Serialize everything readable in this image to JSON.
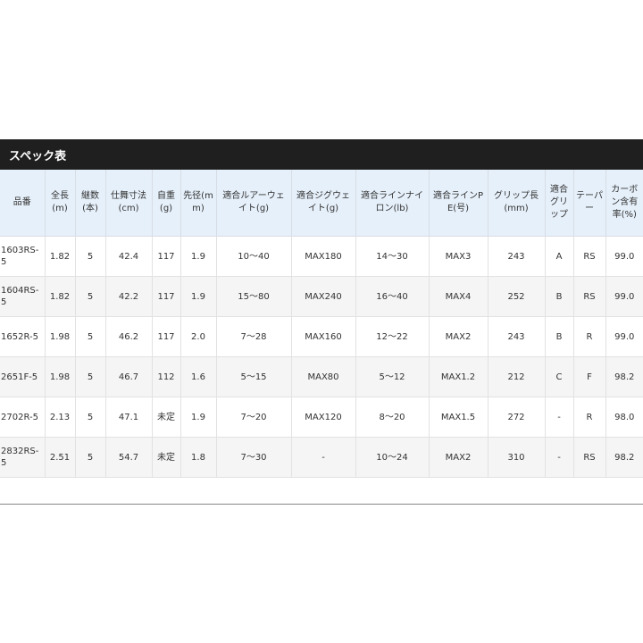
{
  "title": "スペック表",
  "headers": [
    "品番",
    "全長(m)",
    "継数(本)",
    "仕舞寸法(cm)",
    "自重(g)",
    "先径(mm)",
    "適合ルアーウェイト(g)",
    "適合ジグウェイト(g)",
    "適合ラインナイロン(lb)",
    "適合ラインPE(号)",
    "グリップ長(mm)",
    "適合グリップ",
    "テーパー",
    "カーボン含有率(%)"
  ],
  "rows": [
    [
      "1603RS-5",
      "1.82",
      "5",
      "42.4",
      "117",
      "1.9",
      "10〜40",
      "MAX180",
      "14〜30",
      "MAX3",
      "243",
      "A",
      "RS",
      "99.0"
    ],
    [
      "1604RS-5",
      "1.82",
      "5",
      "42.2",
      "117",
      "1.9",
      "15〜80",
      "MAX240",
      "16〜40",
      "MAX4",
      "252",
      "B",
      "RS",
      "99.0"
    ],
    [
      "1652R-5",
      "1.98",
      "5",
      "46.2",
      "117",
      "2.0",
      "7〜28",
      "MAX160",
      "12〜22",
      "MAX2",
      "243",
      "B",
      "R",
      "99.0"
    ],
    [
      "2651F-5",
      "1.98",
      "5",
      "46.7",
      "112",
      "1.6",
      "5〜15",
      "MAX80",
      "5〜12",
      "MAX1.2",
      "212",
      "C",
      "F",
      "98.2"
    ],
    [
      "2702R-5",
      "2.13",
      "5",
      "47.1",
      "未定",
      "1.9",
      "7〜20",
      "MAX120",
      "8〜20",
      "MAX1.5",
      "272",
      "-",
      "R",
      "98.0"
    ],
    [
      "2832RS-5",
      "2.51",
      "5",
      "54.7",
      "未定",
      "1.8",
      "7〜30",
      "-",
      "10〜24",
      "MAX2",
      "310",
      "-",
      "RS",
      "98.2"
    ]
  ]
}
